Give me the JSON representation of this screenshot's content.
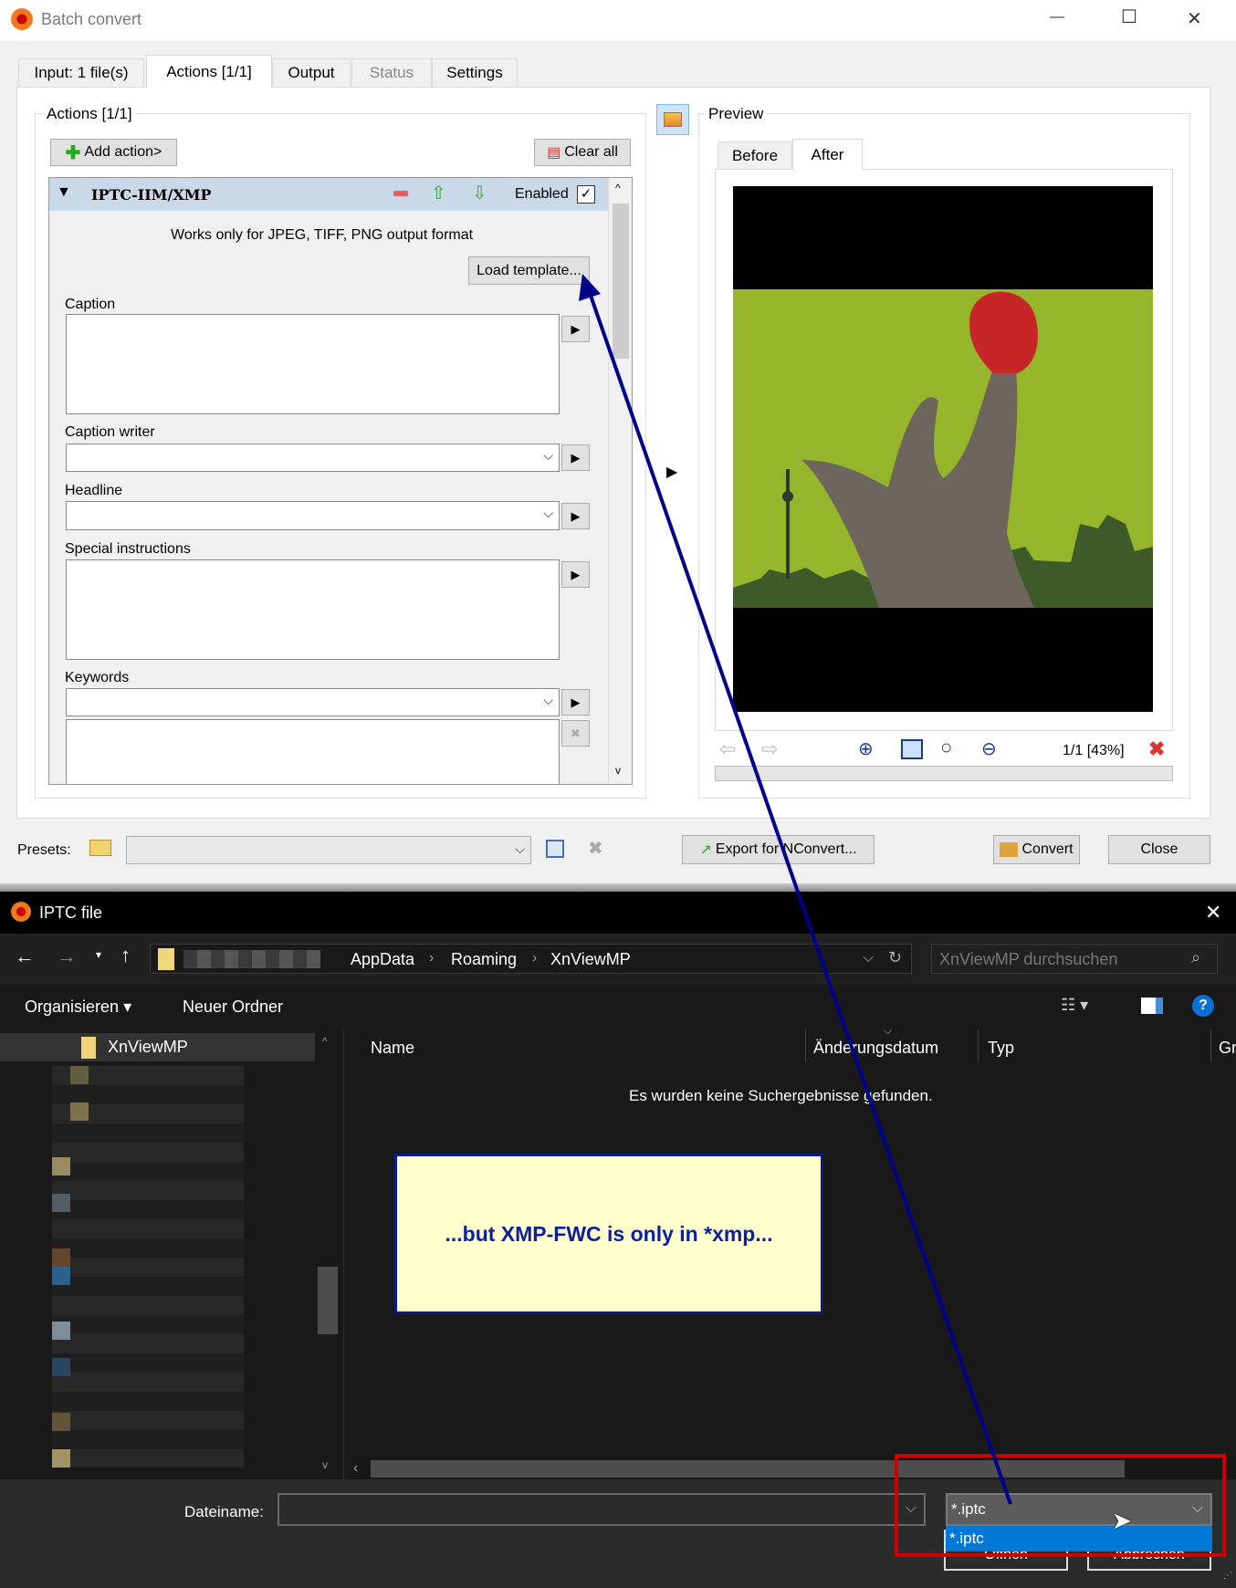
{
  "window": {
    "title": "Batch convert",
    "min": "—",
    "max": "☐",
    "close": "✕"
  },
  "tabs": [
    {
      "label": "Input: 1 file(s)"
    },
    {
      "label": "Actions [1/1]"
    },
    {
      "label": "Output"
    },
    {
      "label": "Status"
    },
    {
      "label": "Settings"
    }
  ],
  "actions": {
    "group_title": "Actions [1/1]",
    "add_action": "Add action>",
    "clear_all": "Clear all",
    "action_name": "IPTC-IIM/XMP",
    "enabled_label": "Enabled",
    "enabled": true,
    "note": "Works only for JPEG, TIFF, PNG output format",
    "load_template": "Load template...",
    "fields": {
      "caption": "Caption",
      "caption_writer": "Caption writer",
      "headline": "Headline",
      "special_instructions": "Special instructions",
      "keywords": "Keywords"
    }
  },
  "preview": {
    "group_title": "Preview",
    "tab_before": "Before",
    "tab_after": "After",
    "page_info": "1/1 [43%]",
    "progress": 0
  },
  "bottom": {
    "presets_label": "Presets:",
    "export": "Export for NConvert...",
    "convert": "Convert",
    "close": "Close"
  },
  "dialog": {
    "title": "IPTC file",
    "close": "✕",
    "breadcrumb": [
      "AppData",
      "Roaming",
      "XnViewMP"
    ],
    "search_placeholder": "XnViewMP durchsuchen",
    "organize": "Organisieren",
    "new_folder": "Neuer Ordner",
    "nav_selected": "XnViewMP",
    "columns": [
      "Name",
      "Änderungsdatum",
      "Typ",
      "Gr"
    ],
    "empty": "Es wurden keine Suchergebnisse gefunden.",
    "filename_label": "Dateiname:",
    "filename_value": "",
    "filter_value": "*.iptc",
    "filter_options": [
      "*.iptc"
    ],
    "open": "Öffnen",
    "cancel": "Abbrechen"
  },
  "annotation": {
    "text": "...but XMP-FWC is only in *xmp...",
    "colors": {
      "arrow": "#00008b",
      "highlight": "#cc0000",
      "note_bg": "#ffffcc"
    }
  }
}
